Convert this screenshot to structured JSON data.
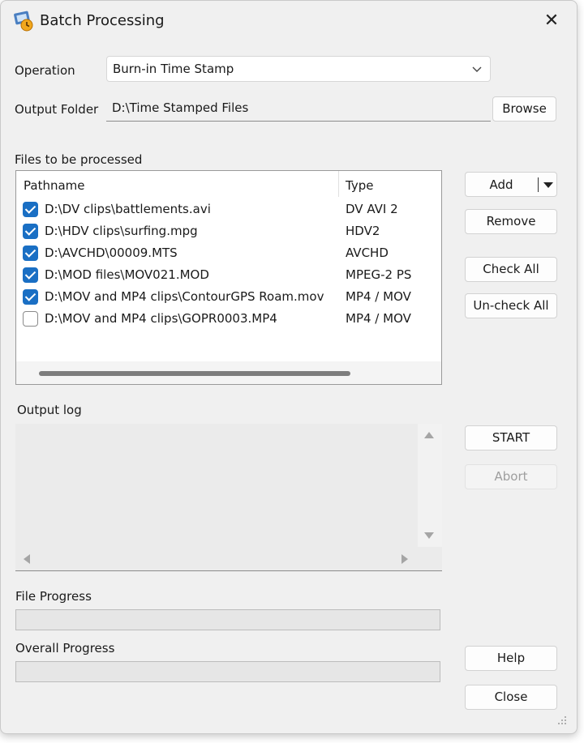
{
  "window": {
    "title": "Batch Processing",
    "app_icon": "batch-processing-app-icon",
    "close_icon": "close-icon"
  },
  "operation": {
    "label": "Operation",
    "selected": "Burn-in Time Stamp"
  },
  "output_folder": {
    "label": "Output Folder",
    "value": "D:\\Time Stamped Files",
    "browse_label": "Browse"
  },
  "files": {
    "section_label": "Files to be processed",
    "columns": [
      "Pathname",
      "Type"
    ],
    "rows": [
      {
        "checked": true,
        "path": "D:\\DV clips\\battlements.avi",
        "type": "DV AVI 2"
      },
      {
        "checked": true,
        "path": "D:\\HDV clips\\surfing.mpg",
        "type": "HDV2"
      },
      {
        "checked": true,
        "path": "D:\\AVCHD\\00009.MTS",
        "type": "AVCHD"
      },
      {
        "checked": true,
        "path": "D:\\MOD files\\MOV021.MOD",
        "type": "MPEG-2 PS"
      },
      {
        "checked": true,
        "path": "D:\\MOV and MP4 clips\\ContourGPS Roam.mov",
        "type": "MP4 / MOV"
      },
      {
        "checked": false,
        "path": "D:\\MOV and MP4 clips\\GOPR0003.MP4",
        "type": "MP4 / MOV"
      }
    ]
  },
  "side_buttons": {
    "add": "Add",
    "remove": "Remove",
    "check_all": "Check All",
    "uncheck_all": "Un-check All",
    "start": "START",
    "abort": "Abort",
    "help": "Help",
    "close": "Close"
  },
  "output_log": {
    "label": "Output log",
    "content": ""
  },
  "progress": {
    "file_label": "File Progress",
    "file_value": 0,
    "overall_label": "Overall Progress",
    "overall_value": 0
  },
  "colors": {
    "checkbox_checked": "#1a6fc4",
    "window_bg": "#f0f0f0",
    "progress_fill": "#06b025"
  }
}
